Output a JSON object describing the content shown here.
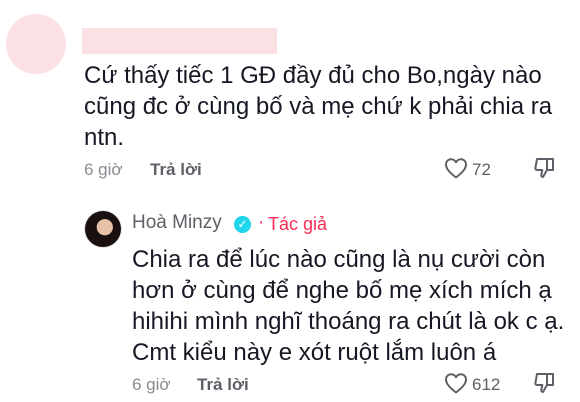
{
  "comment1": {
    "text": "Cứ thấy tiếc 1 GĐ đầy đủ cho Bo,ngày nào cũng đc ở cùng bố và mẹ chứ k phải chia ra ntn.",
    "time": "6 giờ",
    "reply_label": "Trả lời",
    "like_count": "72"
  },
  "reply1": {
    "author": "Hoà Minzy",
    "author_badge": "Tác giả",
    "text": "Chia ra để lúc nào cũng là nụ cười còn hơn ở cùng để nghe bố mẹ xích mích ạ hihihi mình nghĩ thoáng ra chút là ok c ạ. Cmt kiểu này e xót ruột lắm luôn á",
    "time": "6 giờ",
    "reply_label": "Trả lời",
    "like_count": "612"
  },
  "icons": {
    "like": "heart-icon",
    "dislike": "thumbs-down-icon",
    "verified": "verified-check-icon"
  },
  "colors": {
    "accent": "#fe2c55",
    "verified": "#20d5ec",
    "redacted": "#fbe1e3"
  }
}
